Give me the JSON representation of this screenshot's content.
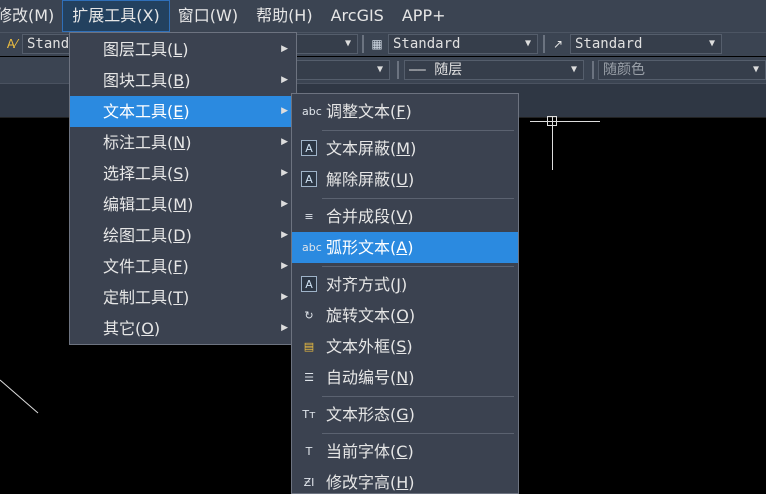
{
  "menubar": {
    "items": [
      {
        "label": "修改(M)"
      },
      {
        "label": "扩展工具(X)"
      },
      {
        "label": "窗口(W)"
      },
      {
        "label": "帮助(H)"
      },
      {
        "label": "ArcGIS"
      },
      {
        "label": "APP+"
      }
    ]
  },
  "toolbar": {
    "text_style": "Stand",
    "table_style": "Standard",
    "mleader_style": "Standard",
    "linetype": "—— 随层",
    "color": "随颜色"
  },
  "menu1": {
    "items": [
      {
        "name": "图层工具",
        "key": "L"
      },
      {
        "name": "图块工具",
        "key": "B"
      },
      {
        "name": "文本工具",
        "key": "E"
      },
      {
        "name": "标注工具",
        "key": "N"
      },
      {
        "name": "选择工具",
        "key": "S"
      },
      {
        "name": "编辑工具",
        "key": "M"
      },
      {
        "name": "绘图工具",
        "key": "D"
      },
      {
        "name": "文件工具",
        "key": "F"
      },
      {
        "name": "定制工具",
        "key": "T"
      },
      {
        "name": "其它",
        "key": "O"
      }
    ]
  },
  "menu2": {
    "items": [
      {
        "name": "调整文本",
        "key": "F",
        "icon": "abc"
      },
      {
        "name": "文本屏蔽",
        "key": "M",
        "icon": "A"
      },
      {
        "name": "解除屏蔽",
        "key": "U",
        "icon": "A"
      },
      {
        "name": "合并成段",
        "key": "V",
        "icon": "≡"
      },
      {
        "name": "弧形文本",
        "key": "A",
        "icon": "abc"
      },
      {
        "name": "对齐方式",
        "key": "J",
        "icon": "A"
      },
      {
        "name": "旋转文本",
        "key": "O",
        "icon": "↻"
      },
      {
        "name": "文本外框",
        "key": "S",
        "icon": "▤"
      },
      {
        "name": "自动编号",
        "key": "N",
        "icon": "☰"
      },
      {
        "name": "文本形态",
        "key": "G",
        "icon": "Tт"
      },
      {
        "name": "当前字体",
        "key": "C",
        "icon": "T"
      },
      {
        "name": "修改字高",
        "key": "H",
        "icon": "ƵI"
      }
    ]
  }
}
